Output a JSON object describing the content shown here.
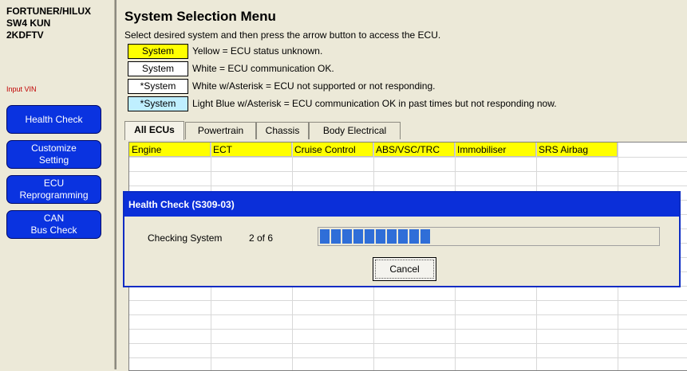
{
  "sidebar": {
    "vehicle_lines": [
      "FORTUNER/HILUX",
      "SW4 KUN",
      "2KDFTV"
    ],
    "input_vin": "Input VIN",
    "buttons": [
      "Health Check",
      "Customize\nSetting",
      "ECU\nReprogramming",
      "CAN\nBus Check"
    ]
  },
  "main": {
    "title": "System Selection Menu",
    "instruction": "Select desired system and then press the arrow button to access the ECU.",
    "legend": [
      {
        "label": "System",
        "text": "Yellow = ECU status unknown.",
        "color": "#ffff00"
      },
      {
        "label": "System",
        "text": "White = ECU communication OK.",
        "color": "#ffffff"
      },
      {
        "label": "*System",
        "text": "White w/Asterisk = ECU not supported or not responding.",
        "color": "#ffffff"
      },
      {
        "label": "*System",
        "text": "Light Blue w/Asterisk = ECU communication OK in past times but not responding now.",
        "color": "#bfefff"
      }
    ],
    "tabs": [
      "All ECUs",
      "Powertrain",
      "Chassis",
      "Body Electrical"
    ],
    "grid_header": [
      "Engine",
      "ECT",
      "Cruise Control",
      "ABS/VSC/TRC",
      "Immobiliser",
      "SRS Airbag"
    ]
  },
  "dialog": {
    "title": "Health Check (S309-03)",
    "checking_label": "Checking System",
    "count_text": "2 of 6",
    "progress": 0.35,
    "cancel_label": "Cancel"
  }
}
